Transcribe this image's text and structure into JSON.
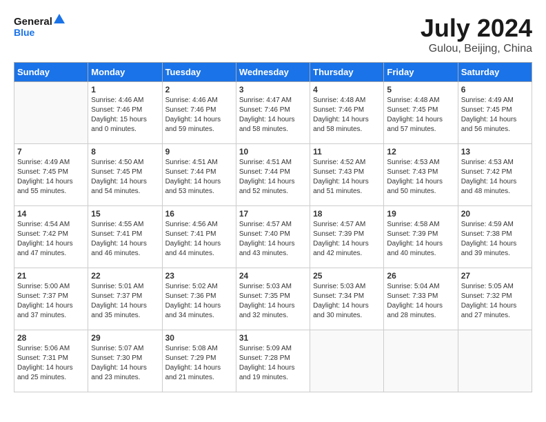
{
  "header": {
    "logo_line1": "General",
    "logo_line2": "Blue",
    "month": "July 2024",
    "location": "Gulou, Beijing, China"
  },
  "columns": [
    "Sunday",
    "Monday",
    "Tuesday",
    "Wednesday",
    "Thursday",
    "Friday",
    "Saturday"
  ],
  "weeks": [
    [
      {
        "day": "",
        "content": ""
      },
      {
        "day": "1",
        "content": "Sunrise: 4:46 AM\nSunset: 7:46 PM\nDaylight: 15 hours\nand 0 minutes."
      },
      {
        "day": "2",
        "content": "Sunrise: 4:46 AM\nSunset: 7:46 PM\nDaylight: 14 hours\nand 59 minutes."
      },
      {
        "day": "3",
        "content": "Sunrise: 4:47 AM\nSunset: 7:46 PM\nDaylight: 14 hours\nand 58 minutes."
      },
      {
        "day": "4",
        "content": "Sunrise: 4:48 AM\nSunset: 7:46 PM\nDaylight: 14 hours\nand 58 minutes."
      },
      {
        "day": "5",
        "content": "Sunrise: 4:48 AM\nSunset: 7:45 PM\nDaylight: 14 hours\nand 57 minutes."
      },
      {
        "day": "6",
        "content": "Sunrise: 4:49 AM\nSunset: 7:45 PM\nDaylight: 14 hours\nand 56 minutes."
      }
    ],
    [
      {
        "day": "7",
        "content": "Sunrise: 4:49 AM\nSunset: 7:45 PM\nDaylight: 14 hours\nand 55 minutes."
      },
      {
        "day": "8",
        "content": "Sunrise: 4:50 AM\nSunset: 7:45 PM\nDaylight: 14 hours\nand 54 minutes."
      },
      {
        "day": "9",
        "content": "Sunrise: 4:51 AM\nSunset: 7:44 PM\nDaylight: 14 hours\nand 53 minutes."
      },
      {
        "day": "10",
        "content": "Sunrise: 4:51 AM\nSunset: 7:44 PM\nDaylight: 14 hours\nand 52 minutes."
      },
      {
        "day": "11",
        "content": "Sunrise: 4:52 AM\nSunset: 7:43 PM\nDaylight: 14 hours\nand 51 minutes."
      },
      {
        "day": "12",
        "content": "Sunrise: 4:53 AM\nSunset: 7:43 PM\nDaylight: 14 hours\nand 50 minutes."
      },
      {
        "day": "13",
        "content": "Sunrise: 4:53 AM\nSunset: 7:42 PM\nDaylight: 14 hours\nand 48 minutes."
      }
    ],
    [
      {
        "day": "14",
        "content": "Sunrise: 4:54 AM\nSunset: 7:42 PM\nDaylight: 14 hours\nand 47 minutes."
      },
      {
        "day": "15",
        "content": "Sunrise: 4:55 AM\nSunset: 7:41 PM\nDaylight: 14 hours\nand 46 minutes."
      },
      {
        "day": "16",
        "content": "Sunrise: 4:56 AM\nSunset: 7:41 PM\nDaylight: 14 hours\nand 44 minutes."
      },
      {
        "day": "17",
        "content": "Sunrise: 4:57 AM\nSunset: 7:40 PM\nDaylight: 14 hours\nand 43 minutes."
      },
      {
        "day": "18",
        "content": "Sunrise: 4:57 AM\nSunset: 7:39 PM\nDaylight: 14 hours\nand 42 minutes."
      },
      {
        "day": "19",
        "content": "Sunrise: 4:58 AM\nSunset: 7:39 PM\nDaylight: 14 hours\nand 40 minutes."
      },
      {
        "day": "20",
        "content": "Sunrise: 4:59 AM\nSunset: 7:38 PM\nDaylight: 14 hours\nand 39 minutes."
      }
    ],
    [
      {
        "day": "21",
        "content": "Sunrise: 5:00 AM\nSunset: 7:37 PM\nDaylight: 14 hours\nand 37 minutes."
      },
      {
        "day": "22",
        "content": "Sunrise: 5:01 AM\nSunset: 7:37 PM\nDaylight: 14 hours\nand 35 minutes."
      },
      {
        "day": "23",
        "content": "Sunrise: 5:02 AM\nSunset: 7:36 PM\nDaylight: 14 hours\nand 34 minutes."
      },
      {
        "day": "24",
        "content": "Sunrise: 5:03 AM\nSunset: 7:35 PM\nDaylight: 14 hours\nand 32 minutes."
      },
      {
        "day": "25",
        "content": "Sunrise: 5:03 AM\nSunset: 7:34 PM\nDaylight: 14 hours\nand 30 minutes."
      },
      {
        "day": "26",
        "content": "Sunrise: 5:04 AM\nSunset: 7:33 PM\nDaylight: 14 hours\nand 28 minutes."
      },
      {
        "day": "27",
        "content": "Sunrise: 5:05 AM\nSunset: 7:32 PM\nDaylight: 14 hours\nand 27 minutes."
      }
    ],
    [
      {
        "day": "28",
        "content": "Sunrise: 5:06 AM\nSunset: 7:31 PM\nDaylight: 14 hours\nand 25 minutes."
      },
      {
        "day": "29",
        "content": "Sunrise: 5:07 AM\nSunset: 7:30 PM\nDaylight: 14 hours\nand 23 minutes."
      },
      {
        "day": "30",
        "content": "Sunrise: 5:08 AM\nSunset: 7:29 PM\nDaylight: 14 hours\nand 21 minutes."
      },
      {
        "day": "31",
        "content": "Sunrise: 5:09 AM\nSunset: 7:28 PM\nDaylight: 14 hours\nand 19 minutes."
      },
      {
        "day": "",
        "content": ""
      },
      {
        "day": "",
        "content": ""
      },
      {
        "day": "",
        "content": ""
      }
    ]
  ]
}
